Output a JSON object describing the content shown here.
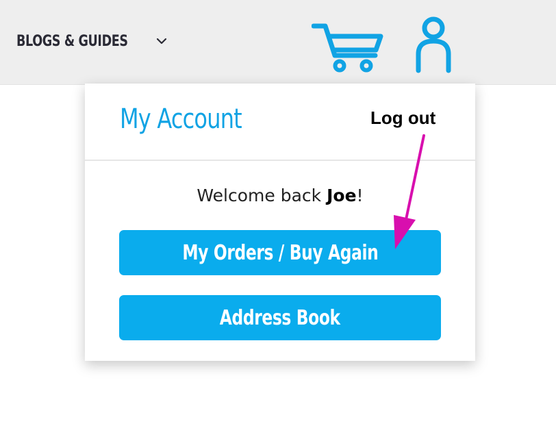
{
  "header": {
    "nav_menu_label": "BLOGS & GUIDES",
    "nav_menu_icon": "chevron-down-icon",
    "cart_icon": "cart-icon",
    "user_icon": "user-icon"
  },
  "account_dropdown": {
    "title": "My Account",
    "logout_label": "Log out",
    "welcome_prefix": "Welcome back",
    "user_name": "Joe",
    "welcome_suffix": "!",
    "buttons": [
      {
        "label": "My Orders / Buy Again"
      },
      {
        "label": "Address Book"
      }
    ]
  },
  "annotation": {
    "arrow_color": "#d80fae"
  },
  "colors": {
    "accent": "#0aaced",
    "title": "#11a3e4",
    "header_bg": "#eeeeee"
  }
}
